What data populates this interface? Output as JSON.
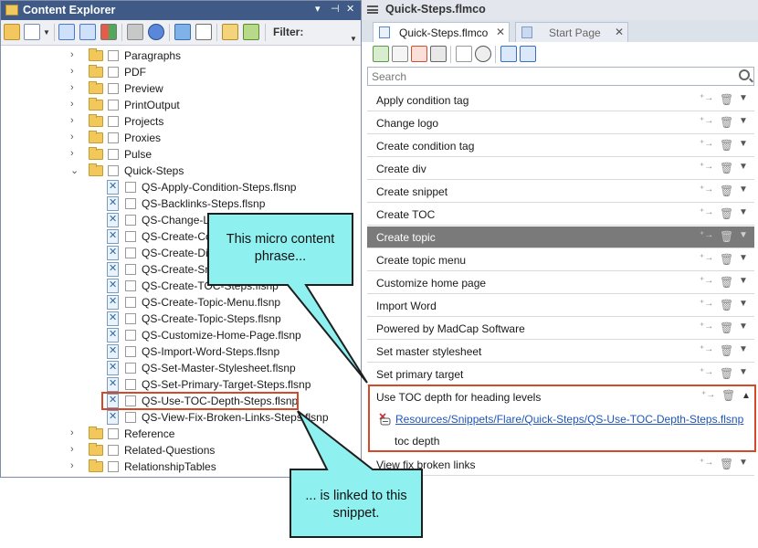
{
  "content_explorer": {
    "title": "Content Explorer",
    "controls": [
      "▾",
      "⊣",
      "✕"
    ],
    "filter_label": "Filter:",
    "tree": [
      {
        "label": "Paragraphs",
        "type": "folder",
        "expander": "›"
      },
      {
        "label": "PDF",
        "type": "folder",
        "expander": "›"
      },
      {
        "label": "Preview",
        "type": "folder",
        "expander": "›"
      },
      {
        "label": "PrintOutput",
        "type": "folder",
        "expander": "›"
      },
      {
        "label": "Projects",
        "type": "folder",
        "expander": "›"
      },
      {
        "label": "Proxies",
        "type": "folder",
        "expander": "›"
      },
      {
        "label": "Pulse",
        "type": "folder",
        "expander": "›"
      },
      {
        "label": "Quick-Steps",
        "type": "folder",
        "expander": "⌄"
      },
      {
        "label": "QS-Apply-Condition-Steps.flsnp",
        "type": "snippet"
      },
      {
        "label": "QS-Backlinks-Steps.flsnp",
        "type": "snippet"
      },
      {
        "label": "QS-Change-L",
        "type": "snippet"
      },
      {
        "label": "QS-Create-Co",
        "type": "snippet"
      },
      {
        "label": "QS-Create-Di",
        "type": "snippet"
      },
      {
        "label": "QS-Create-Sn",
        "type": "snippet"
      },
      {
        "label": "QS-Create-TOC-Steps.flsnp",
        "type": "snippet"
      },
      {
        "label": "QS-Create-Topic-Menu.flsnp",
        "type": "snippet"
      },
      {
        "label": "QS-Create-Topic-Steps.flsnp",
        "type": "snippet"
      },
      {
        "label": "QS-Customize-Home-Page.flsnp",
        "type": "snippet"
      },
      {
        "label": "QS-Import-Word-Steps.flsnp",
        "type": "snippet"
      },
      {
        "label": "QS-Set-Master-Stylesheet.flsnp",
        "type": "snippet"
      },
      {
        "label": "QS-Set-Primary-Target-Steps.flsnp",
        "type": "snippet"
      },
      {
        "label": "QS-Use-TOC-Depth-Steps.flsnp",
        "type": "snippet"
      },
      {
        "label": "QS-View-Fix-Broken-Links-Steps.flsnp",
        "type": "snippet"
      },
      {
        "label": "Reference",
        "type": "folder",
        "expander": "›"
      },
      {
        "label": "Related-Questions",
        "type": "folder",
        "expander": "›"
      },
      {
        "label": "RelationshipTables",
        "type": "folder",
        "expander": "›"
      }
    ]
  },
  "editor": {
    "window_title": "Quick-Steps.flmco",
    "tabs": [
      {
        "label": "Quick-Steps.flmco",
        "close": "✕"
      },
      {
        "label": "Start Page",
        "close": "✕"
      }
    ],
    "search_placeholder": "Search",
    "phrases": [
      "Apply condition tag",
      "Change logo",
      "Create condition tag",
      "Create div",
      "Create snippet",
      "Create TOC",
      "Create topic",
      "Create topic menu",
      "Customize home page",
      "Import Word",
      "Powered by MadCap Software",
      "Set master stylesheet",
      "Set primary target"
    ],
    "selected_phrase": "Create topic",
    "expanded": {
      "phrase": "Use TOC depth for heading levels",
      "link": "Resources/Snippets/Flare/Quick-Steps/QS-Use-TOC-Depth-Steps.flsnp",
      "response_text": "toc depth"
    },
    "after_expanded": "View fix broken links",
    "row_icons": {
      "add": "⁺→",
      "delete": "🗑",
      "expand": "▼",
      "collapse": "▲"
    }
  },
  "callouts": {
    "top": "This micro content phrase...",
    "bottom": "... is linked to this snippet."
  },
  "colors": {
    "accent_red": "#d24a2a",
    "callout_fill": "#8ef0ef",
    "title_bar": "#3f5a86",
    "selected_row": "#7a7a7a",
    "link": "#1d55b8"
  }
}
